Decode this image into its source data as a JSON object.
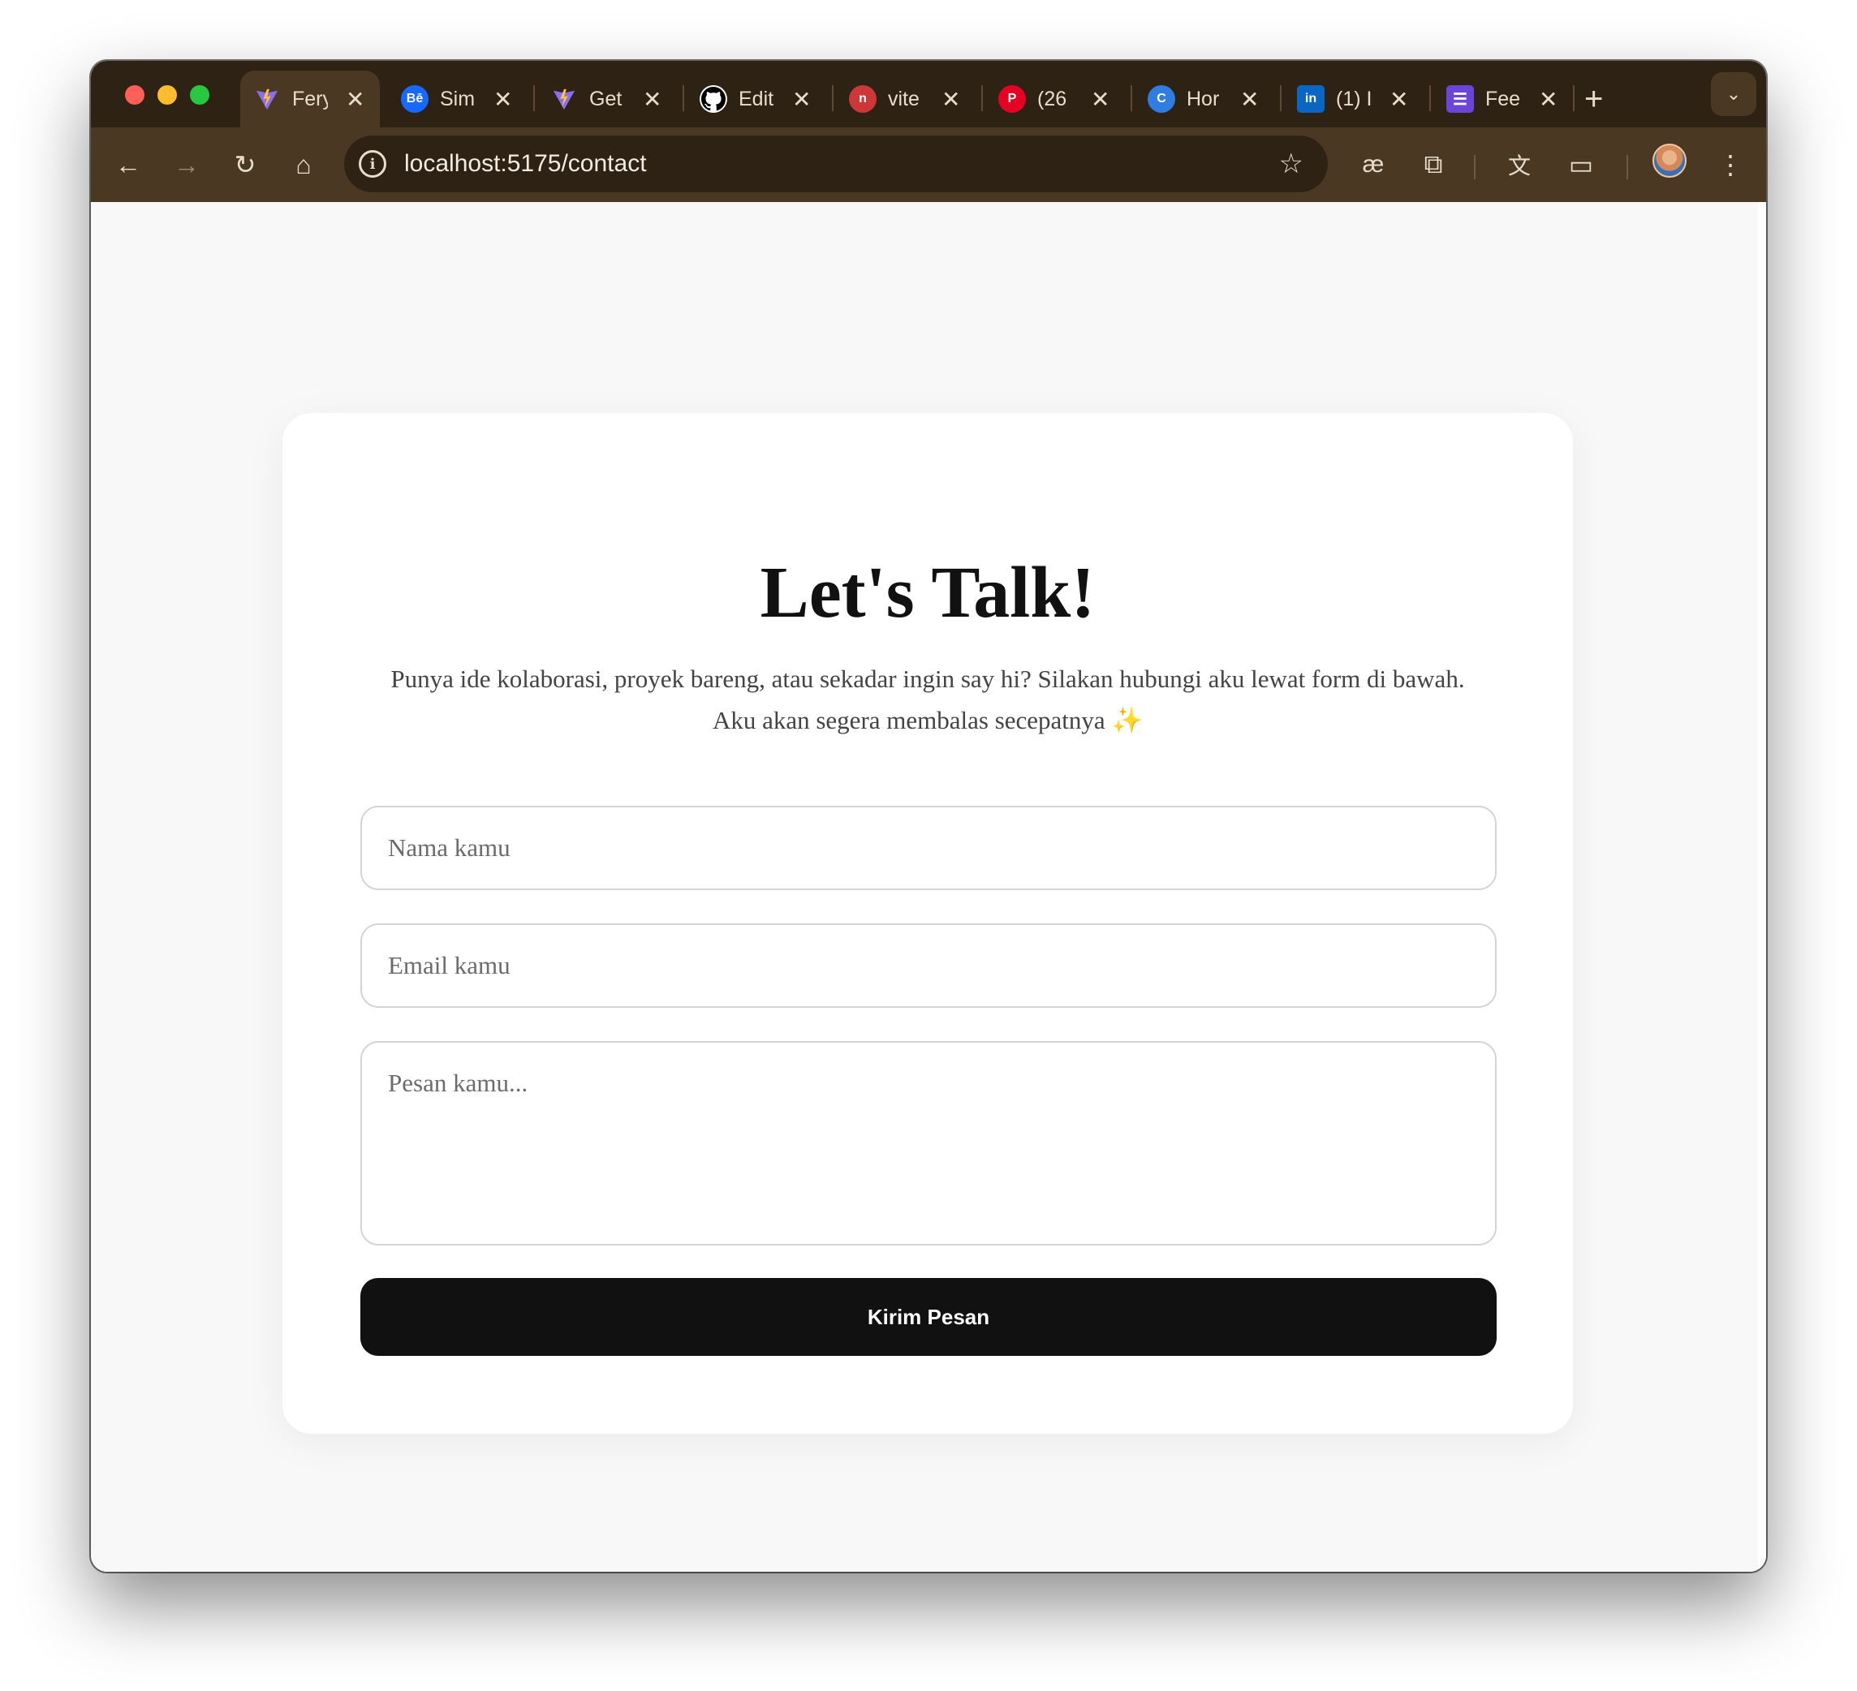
{
  "browser": {
    "tabs": [
      {
        "title": "Fery",
        "favicon": "vite-logo-icon",
        "active": true
      },
      {
        "title": "Sim",
        "favicon": "behance-icon",
        "active": false
      },
      {
        "title": "Get",
        "favicon": "vite-logo-icon",
        "active": false
      },
      {
        "title": "Edit",
        "favicon": "github-icon",
        "active": false
      },
      {
        "title": "vite",
        "favicon": "npm-icon",
        "active": false
      },
      {
        "title": "(26",
        "favicon": "pinterest-icon",
        "active": false
      },
      {
        "title": "Hor",
        "favicon": "c-circle-icon",
        "active": false
      },
      {
        "title": "(1) I",
        "favicon": "linkedin-icon",
        "active": false
      },
      {
        "title": "Fee",
        "favicon": "list-icon",
        "active": false
      }
    ],
    "url": "localhost:5175/contact",
    "colors": {
      "frame": "#2e2215",
      "toolbar": "#4a3823",
      "text": "#e8ddcc"
    }
  },
  "contact": {
    "heading": "Let's Talk!",
    "subtitle_line1": "Punya ide kolaborasi, proyek bareng, atau sekadar ingin say hi? Silakan hubungi aku lewat form di bawah.",
    "subtitle_line2": "Aku akan segera membalas secepatnya",
    "sparkle": "✨",
    "name_placeholder": "Nama kamu",
    "email_placeholder": "Email kamu",
    "message_placeholder": "Pesan kamu...",
    "submit_label": "Kirim Pesan"
  }
}
